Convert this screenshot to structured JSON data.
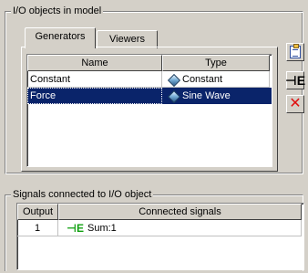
{
  "io_group": {
    "title": "I/O objects in model",
    "tabs": [
      {
        "label": "Generators"
      },
      {
        "label": "Viewers"
      }
    ],
    "generators": {
      "columns": [
        "Name",
        "Type"
      ],
      "rows": [
        {
          "name": "Constant",
          "type": "Constant",
          "icon": "diamond-icon",
          "selected": false
        },
        {
          "name": "Force",
          "type": "Sine Wave",
          "icon": "diamond-icon",
          "selected": true
        }
      ]
    },
    "buttons": [
      {
        "name": "properties",
        "icon": "clipboard-icon"
      },
      {
        "name": "connect",
        "icon": "connect-icon",
        "glyph": "⊣E"
      },
      {
        "name": "delete",
        "icon": "delete-icon",
        "glyph": "✕"
      }
    ]
  },
  "signals_group": {
    "title": "Signals connected to I/O object",
    "columns": [
      "Output",
      "Connected signals"
    ],
    "rows": [
      {
        "output": "1",
        "signal": "Sum:1",
        "icon": "signal-icon"
      }
    ]
  },
  "colors": {
    "background": "#d4d0c8",
    "selection": "#0a246a",
    "signal_icon": "#10a010",
    "delete_icon": "#e01010"
  }
}
